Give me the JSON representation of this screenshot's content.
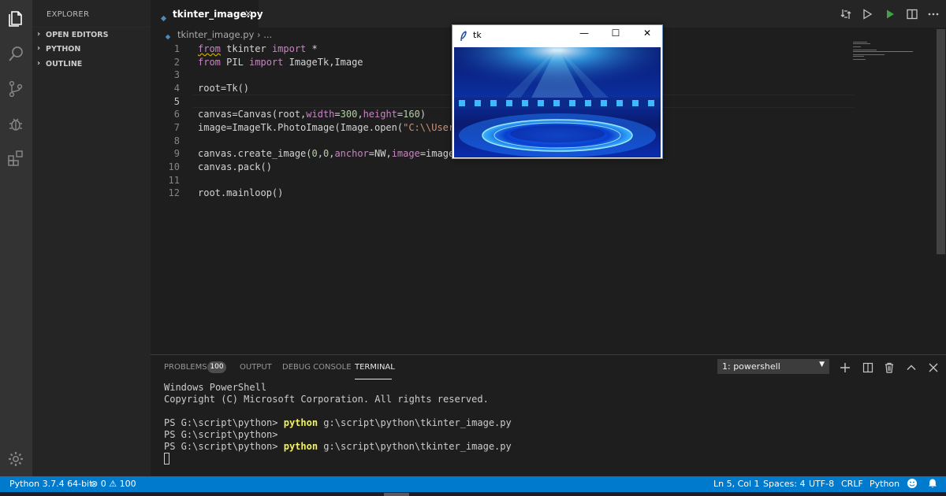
{
  "sidebar": {
    "title": "EXPLORER",
    "sections": [
      "OPEN EDITORS",
      "PYTHON",
      "OUTLINE"
    ]
  },
  "activity_icons": [
    "files-icon",
    "search-icon",
    "source-control-icon",
    "debug-icon",
    "extensions-icon",
    "settings-gear-icon"
  ],
  "tab": {
    "name": "tkinter_image.py",
    "close": "×"
  },
  "breadcrumb": {
    "file": "tkinter_image.py",
    "sep": "›",
    "more": "..."
  },
  "editor": {
    "line_numbers": [
      "1",
      "2",
      "3",
      "4",
      "5",
      "6",
      "7",
      "8",
      "9",
      "10",
      "11",
      "12"
    ],
    "current_line": 5,
    "code": {
      "l1": {
        "kw1": "from",
        "mod": " tkinter ",
        "kw2": "import",
        "rest": " *"
      },
      "l2": {
        "kw1": "from",
        "mod": " PIL ",
        "kw2": "import",
        "rest": " ImageTk,Image"
      },
      "l4": "root=Tk()",
      "l6": {
        "a": "canvas=Canvas(root,",
        "kw1": "width",
        "b": "=",
        "n1": "300",
        "c": ",",
        "kw2": "height",
        "d": "=",
        "n2": "160",
        "e": ")"
      },
      "l7": {
        "a": "image=ImageTk.PhotoImage(Image.open(",
        "s": "\"C:\\\\Users\\\\"
      },
      "l9": {
        "a": "canvas.create_image(",
        "n1": "0",
        "b": ",",
        "n2": "0",
        "c": ",",
        "kw1": "anchor",
        "d": "=NW,",
        "kw2": "image",
        "e": "=image)"
      },
      "l10": "canvas.pack()",
      "l12": "root.mainloop()"
    }
  },
  "tk_window": {
    "title": "tk",
    "min": "—",
    "max": "☐",
    "close": "✕"
  },
  "panel": {
    "tabs": [
      "PROBLEMS",
      "OUTPUT",
      "DEBUG CONSOLE",
      "TERMINAL"
    ],
    "problems_count": "100",
    "active_tab": "TERMINAL",
    "terminal_select": "1: powershell",
    "terminal_lines": [
      "Windows PowerShell",
      "Copyright (C) Microsoft Corporation. All rights reserved.",
      "",
      {
        "prompt": "PS G:\\script\\python> ",
        "cmd": "python",
        "args": " g:\\script\\python\\tkinter_image.py"
      },
      {
        "prompt": "PS G:\\script\\python>"
      },
      {
        "prompt": "PS G:\\script\\python> ",
        "cmd": "python",
        "args": " g:\\script\\python\\tkinter_image.py"
      }
    ]
  },
  "status": {
    "interpreter": "Python 3.7.4 64-bit",
    "errors": "0",
    "warnings": "100",
    "position": "Ln 5, Col 1",
    "spaces": "Spaces: 4",
    "encoding": "UTF-8",
    "eol": "CRLF",
    "language": "Python"
  },
  "colors": {
    "activity_bar": "#333333",
    "sidebar": "#252526",
    "editor_bg": "#1e1e1e",
    "status_bar": "#007acc",
    "keyword": "#c586c0",
    "number": "#b5cea8",
    "string": "#ce9178"
  }
}
